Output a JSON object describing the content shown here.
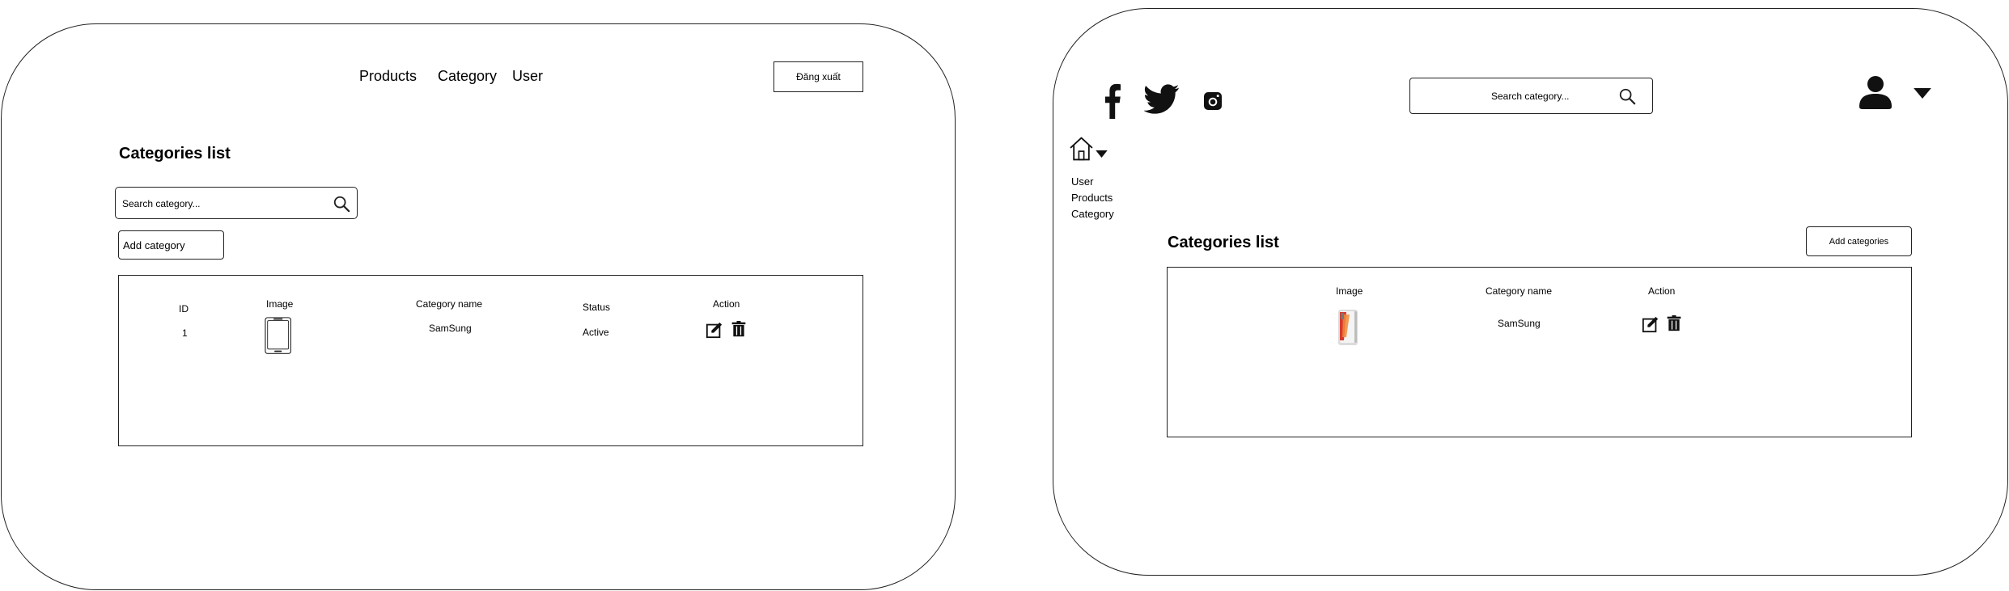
{
  "left_panel": {
    "nav": [
      "Products",
      "Category",
      "User"
    ],
    "logout_label": "Đăng xuất",
    "page_title": "Categories list",
    "search_placeholder": "Search category...",
    "add_label": "Add category",
    "table": {
      "headers": {
        "id": "ID",
        "image": "Image",
        "category_name": "Category name",
        "status": "Status",
        "action": "Action"
      },
      "rows": [
        {
          "id": "1",
          "category_name": "SamSung",
          "status": "Active",
          "image_icon": "tablet-icon"
        }
      ]
    }
  },
  "right_panel": {
    "social_icons": [
      "facebook-icon",
      "twitter-icon",
      "instagram-icon"
    ],
    "search_placeholder": "Search category...",
    "sidebar": {
      "items": [
        "User",
        "Products",
        "Category"
      ]
    },
    "page_title": "Categories list",
    "add_label": "Add categories",
    "table": {
      "headers": {
        "image": "Image",
        "category_name": "Category name",
        "action": "Action"
      },
      "rows": [
        {
          "category_name": "SamSung",
          "image_icon": "phone-image-icon"
        }
      ]
    }
  },
  "colors": {
    "stroke": "#222222",
    "phone_red": "#d63a2f",
    "phone_silver": "#e6e6e6"
  }
}
